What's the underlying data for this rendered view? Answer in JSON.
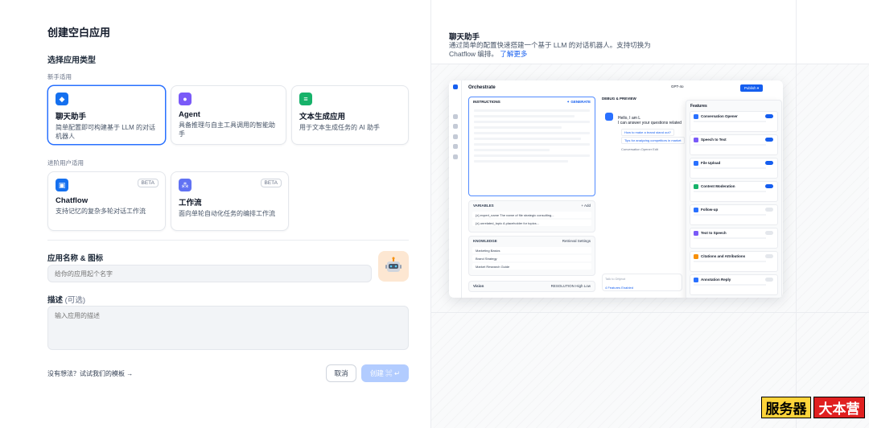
{
  "dialog": {
    "title": "创建空白应用",
    "app_type_label": "选择应用类型",
    "beginner_group": "新手适用",
    "advanced_group": "进阶用户适用",
    "cards": [
      {
        "id": "chatbot",
        "title": "聊天助手",
        "desc": "简单配置即可构建基于 LLM 的对话机器人",
        "icon_color": "#1570ef",
        "selected": true
      },
      {
        "id": "agent",
        "title": "Agent",
        "desc": "具备推理与自主工具调用的智能助手",
        "icon_color": "#7a5af8",
        "selected": false
      },
      {
        "id": "completion",
        "title": "文本生成应用",
        "desc": "用于文本生成任务的 AI 助手",
        "icon_color": "#17b26a",
        "selected": false
      },
      {
        "id": "chatflow",
        "title": "Chatflow",
        "desc": "支持记忆的复杂多轮对话工作流",
        "badge": "BETA",
        "icon_color": "#1570ef",
        "selected": false
      },
      {
        "id": "workflow",
        "title": "工作流",
        "desc": "面向单轮自动化任务的编排工作流",
        "badge": "BETA",
        "icon_color": "#6172f3",
        "selected": false
      }
    ],
    "name_label": "应用名称 & 图标",
    "name_placeholder": "给你的应用起个名字",
    "desc_label": "描述",
    "desc_optional": "(可选)",
    "desc_placeholder": "输入应用的描述",
    "template_link": "没有想法？试试我们的模板 →",
    "cancel_label": "取消",
    "create_label": "创建 ⌘ ↵"
  },
  "preview": {
    "title": "聊天助手",
    "desc": "通过简单的配置快速搭建一个基于 LLM 的对话机器人。支持切换为 Chatflow 编排。",
    "learn_more": "了解更多",
    "mini": {
      "orchestrate": "Orchestrate",
      "instructions": "INSTRUCTIONS",
      "generate": "✦ GENERATE",
      "variables": "VARIABLES",
      "add": "+ Add",
      "var_rows": [
        "{x} expert_name   The name of file strategic consulting...",
        "{x} unrelated_topic   A placeholder for topics..."
      ],
      "knowledge": "KNOWLEDGE",
      "retrieval": "Retrieval Settings",
      "kb_rows": [
        "Marketing Basics",
        "Brand Strategy",
        "Market Research Guide"
      ],
      "vision": "Vision",
      "resolution": "RESOLUTION",
      "high": "High",
      "low": "Low",
      "debug": "DEBUG & PREVIEW",
      "chat_line1": "Hello, I am L",
      "chat_line2": "I can answer your questions related",
      "suggestions": [
        "How to make a brand stand out?",
        "Tips for analyzing competitors in market"
      ],
      "opener": "Conversation Opener   Edit",
      "talk": "Talk to Difybot",
      "features_enabled": "4 Features Enabled",
      "model": "GPT-4o",
      "publish": "Publish ▾",
      "features_title": "Features",
      "features": [
        {
          "name": "Conversation Opener",
          "on": true,
          "color": "#2970ff"
        },
        {
          "name": "Speech to Text",
          "on": true,
          "color": "#7a5af8"
        },
        {
          "name": "File Upload",
          "on": true,
          "color": "#2970ff"
        },
        {
          "name": "Content Moderation",
          "on": true,
          "color": "#17b26a"
        },
        {
          "name": "Follow-up",
          "on": false,
          "color": "#2970ff"
        },
        {
          "name": "Text to Speech",
          "on": false,
          "color": "#7a5af8"
        },
        {
          "name": "Citations and Attributions",
          "on": false,
          "color": "#f79009"
        },
        {
          "name": "Annotation Reply",
          "on": false,
          "color": "#2970ff"
        }
      ]
    }
  },
  "watermark": {
    "part1": "服务器",
    "part2": "大本营"
  }
}
